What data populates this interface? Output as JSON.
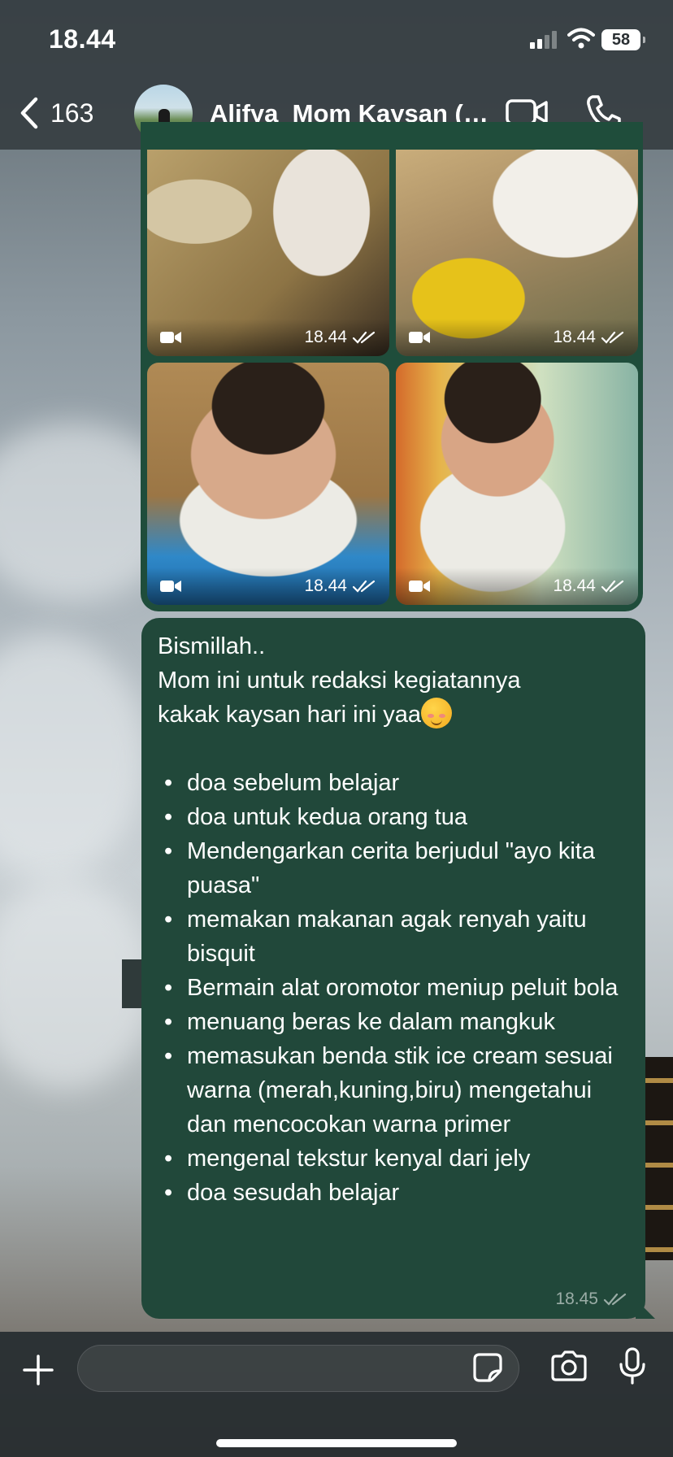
{
  "status_bar": {
    "time": "18.44",
    "battery": "58"
  },
  "header": {
    "back_count": "163",
    "chat_title": "Alifya_Mom Kaysan (…"
  },
  "media": {
    "tiles": [
      {
        "time": "18.44",
        "type": "video"
      },
      {
        "time": "18.44",
        "type": "video"
      },
      {
        "time": "18.44",
        "type": "video"
      },
      {
        "time": "18.44",
        "type": "video"
      }
    ]
  },
  "message": {
    "line1": "Bismillah..",
    "line2": "Mom ini untuk redaksi kegiatannya",
    "line3": "kakak kaysan hari ini yaa",
    "emoji": "smiling-face-emoji",
    "items": [
      "doa sebelum belajar",
      "doa untuk kedua orang tua",
      "Mendengarkan cerita berjudul \"ayo kita puasa\"",
      "memakan makanan agak renyah yaitu bisquit",
      "Bermain alat oromotor meniup peluit bola",
      "menuang beras ke dalam mangkuk",
      "memasukan benda stik ice cream sesuai warna (merah,kuning,biru) mengetahui dan mencocokan warna primer",
      "mengenal tekstur kenyal dari jely",
      "doa sesudah belajar"
    ],
    "time": "18.45"
  },
  "composer": {
    "placeholder": ""
  },
  "colors": {
    "bubble": "#21483a",
    "bar": "#363e42"
  }
}
